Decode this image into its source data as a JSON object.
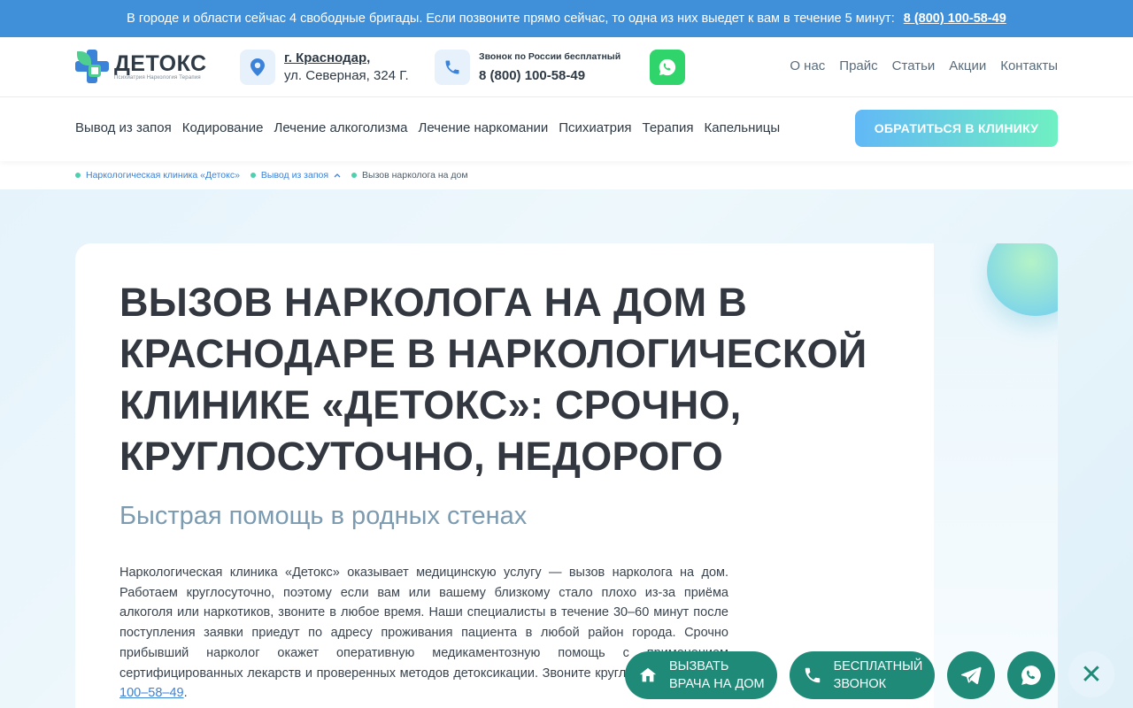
{
  "topbar": {
    "text": "В городе и области сейчас 4 свободные бригады. Если позвоните прямо сейчас, то одна из них выедет к вам в течение 5 минут:",
    "phone": "8 (800) 100-58-49"
  },
  "header": {
    "logo_name": "ДЕТОКС",
    "logo_sub": "Психиатрия Наркология Терапия",
    "city": "г. Краснодар,",
    "street": "ул. Северная, 324 Г.",
    "phone_caption": "Звонок по России бесплатный",
    "phone": "8 (800) 100-58-49",
    "top_links": [
      "О нас",
      "Прайс",
      "Статьи",
      "Акции",
      "Контакты"
    ]
  },
  "mainnav": {
    "items": [
      "Вывод из запоя",
      "Кодирование",
      "Лечение алкоголизма",
      "Лечение наркомании",
      "Психиатрия",
      "Терапия",
      "Капельницы"
    ],
    "cta": "ОБРАТИТЬСЯ В КЛИНИКУ"
  },
  "breadcrumbs": [
    "Наркологическая клиника «Детокс»",
    "Вывод из запоя",
    "Вызов нарколога на дом"
  ],
  "hero": {
    "title": "Вызов нарколога на дом в Краснодаре в наркологической клинике «Детокс»: срочно, круглосуточно, недорого",
    "subtitle": "Быстрая помощь в родных стенах",
    "intro": "Наркологическая клиника «Детокс» оказывает медицинскую услугу — вызов нарколога на дом. Работаем круглосуточно, поэтому если вам или вашему близкому стало плохо из-за приёма алкоголя или наркотиков, звоните в любое время. Наши специалисты в течение 30–60 минут после поступления заявки приедут по адресу проживания пациента в любой район города. Срочно прибывший нарколог окажет оперативную медикаментозную помощь с применением сертифицированных лекарств и проверенных методов детоксикации. Звоните круглосуточно:",
    "intro_phone": "8 (800) 100–58–49",
    "intro_end": "."
  },
  "floating": {
    "call_doctor_line1": "Вызвать",
    "call_doctor_line2": "врача на дом",
    "free_call_line1": "Бесплатный",
    "free_call_line2": "звонок",
    "close": "✕"
  },
  "colors": {
    "topbar": "#4090d9",
    "brand_blue": "#3b82d9",
    "brand_green": "#4ecf8f",
    "float_teal": "#1f8a78"
  },
  "icons": [
    "map-pin-icon",
    "phone-icon",
    "whatsapp-icon",
    "home-icon",
    "telegram-icon",
    "close-icon"
  ]
}
